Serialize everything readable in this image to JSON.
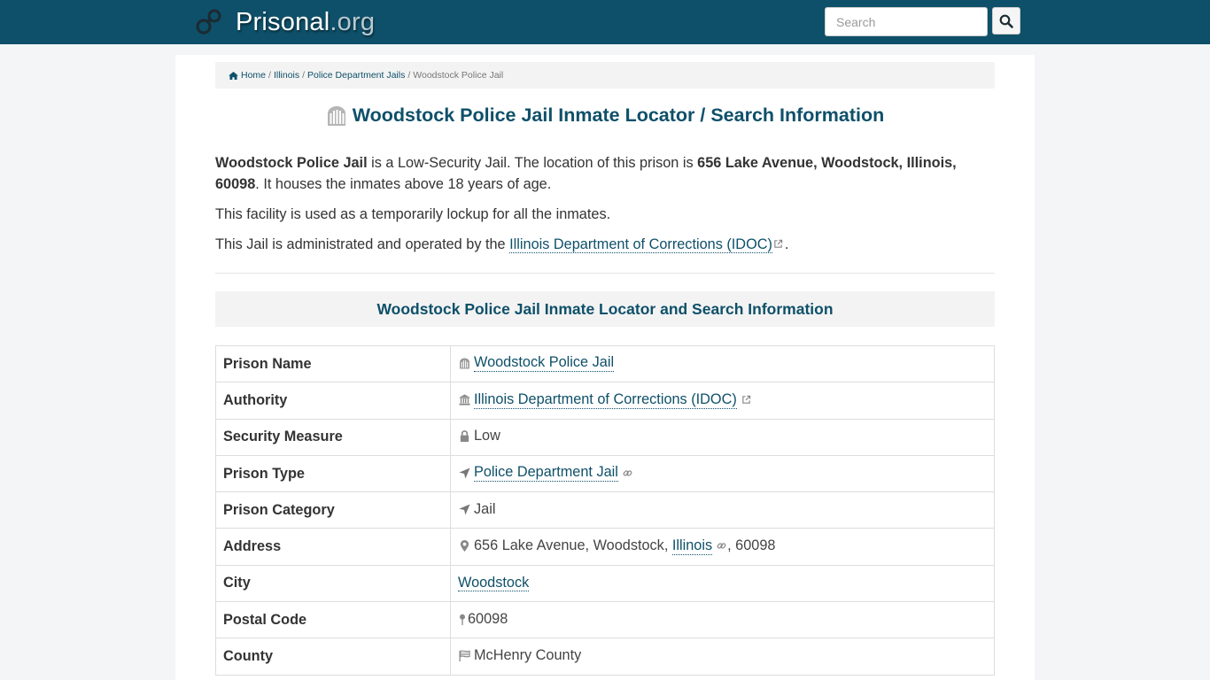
{
  "header": {
    "brand_name": "Prisonal",
    "brand_ext": ".org",
    "search_placeholder": "Search",
    "search_value": ""
  },
  "breadcrumb": {
    "items": [
      "Home",
      "Illinois",
      "Police Department Jails"
    ],
    "current": "Woodstock Police Jail",
    "separator": "/"
  },
  "page": {
    "title": "Woodstock Police Jail Inmate Locator / Search Information",
    "intro": {
      "p1_name": "Woodstock Police Jail",
      "p1_text_a": " is a Low-Security Jail. The location of this prison is ",
      "p1_address": "656 Lake Avenue, Woodstock, Illinois, 60098",
      "p1_text_b": ". It houses the inmates above 18 years of age.",
      "p2": "This facility is used as a temporarily lockup for all the inmates.",
      "p3_text": "This Jail is administrated and operated by the ",
      "p3_link": "Illinois Department of Corrections (IDOC)",
      "p3_end": "."
    },
    "section_title": "Woodstock Police Jail Inmate Locator and Search Information"
  },
  "table": {
    "rows": [
      {
        "label": "Prison Name",
        "value": "Woodstock Police Jail",
        "icon": "prison-building-icon",
        "link": true
      },
      {
        "label": "Authority",
        "value": "Illinois Department of Corrections (IDOC)",
        "icon": "institution-icon",
        "link": true,
        "external": true
      },
      {
        "label": "Security Measure",
        "value": "Low",
        "icon": "lock-icon",
        "link": false
      },
      {
        "label": "Prison Type",
        "value": "Police Department Jail",
        "icon": "location-arrow-icon",
        "link": true,
        "chain": true
      },
      {
        "label": "Prison Category",
        "value": "Jail",
        "icon": "location-arrow-icon",
        "link": false
      },
      {
        "label": "Address",
        "value_street": "656 Lake Avenue, Woodstock, ",
        "value_state": "Illinois",
        "value_zip": ", 60098",
        "icon": "map-marker-icon"
      },
      {
        "label": "City",
        "value": "Woodstock",
        "link": true
      },
      {
        "label": "Postal Code",
        "value": "60098",
        "icon": "map-pin-icon",
        "link": false
      },
      {
        "label": "County",
        "value": "McHenry County",
        "icon": "flag-icon",
        "link": false
      }
    ]
  },
  "colors": {
    "brand": "#0e5069",
    "background": "#f3f5f6",
    "panel": "#f3f3f3"
  }
}
